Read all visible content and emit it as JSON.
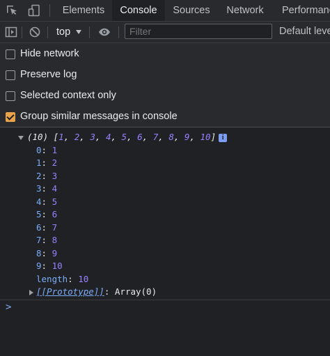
{
  "tabs": [
    {
      "label": "Elements",
      "active": false
    },
    {
      "label": "Console",
      "active": true
    },
    {
      "label": "Sources",
      "active": false
    },
    {
      "label": "Network",
      "active": false
    },
    {
      "label": "Performanc",
      "active": false
    }
  ],
  "toolbar": {
    "context": "top",
    "filter_placeholder": "Filter",
    "levels_label": "Default leve"
  },
  "settings": [
    {
      "label": "Hide network",
      "checked": false
    },
    {
      "label": "Preserve log",
      "checked": false
    },
    {
      "label": "Selected context only",
      "checked": false
    },
    {
      "label": "Group similar messages in console",
      "checked": true
    }
  ],
  "output": {
    "summary_prefix": "(10) [",
    "summary_values": [
      "1",
      "2",
      "3",
      "4",
      "5",
      "6",
      "7",
      "8",
      "9",
      "10"
    ],
    "summary_suffix": "]",
    "info_glyph": "i",
    "entries": [
      {
        "key": "0",
        "value": "1"
      },
      {
        "key": "1",
        "value": "2"
      },
      {
        "key": "2",
        "value": "3"
      },
      {
        "key": "3",
        "value": "4"
      },
      {
        "key": "4",
        "value": "5"
      },
      {
        "key": "5",
        "value": "6"
      },
      {
        "key": "6",
        "value": "7"
      },
      {
        "key": "7",
        "value": "8"
      },
      {
        "key": "8",
        "value": "9"
      },
      {
        "key": "9",
        "value": "10"
      }
    ],
    "length_key": "length",
    "length_value": "10",
    "prototype_key": "[[Prototype]]",
    "prototype_value": "Array(0)",
    "prompt": ">"
  },
  "colors": {
    "background": "#202124",
    "toolbar": "#292a2d",
    "number": "#9980ff",
    "key": "#7cacf8",
    "checkbox_checked": "#e8a34a"
  },
  "icons": {
    "inspect": "inspect-element-icon",
    "device": "device-toggle-icon",
    "sidebar": "show-sidebar-icon",
    "clear": "clear-console-icon",
    "eye": "live-expression-icon"
  }
}
